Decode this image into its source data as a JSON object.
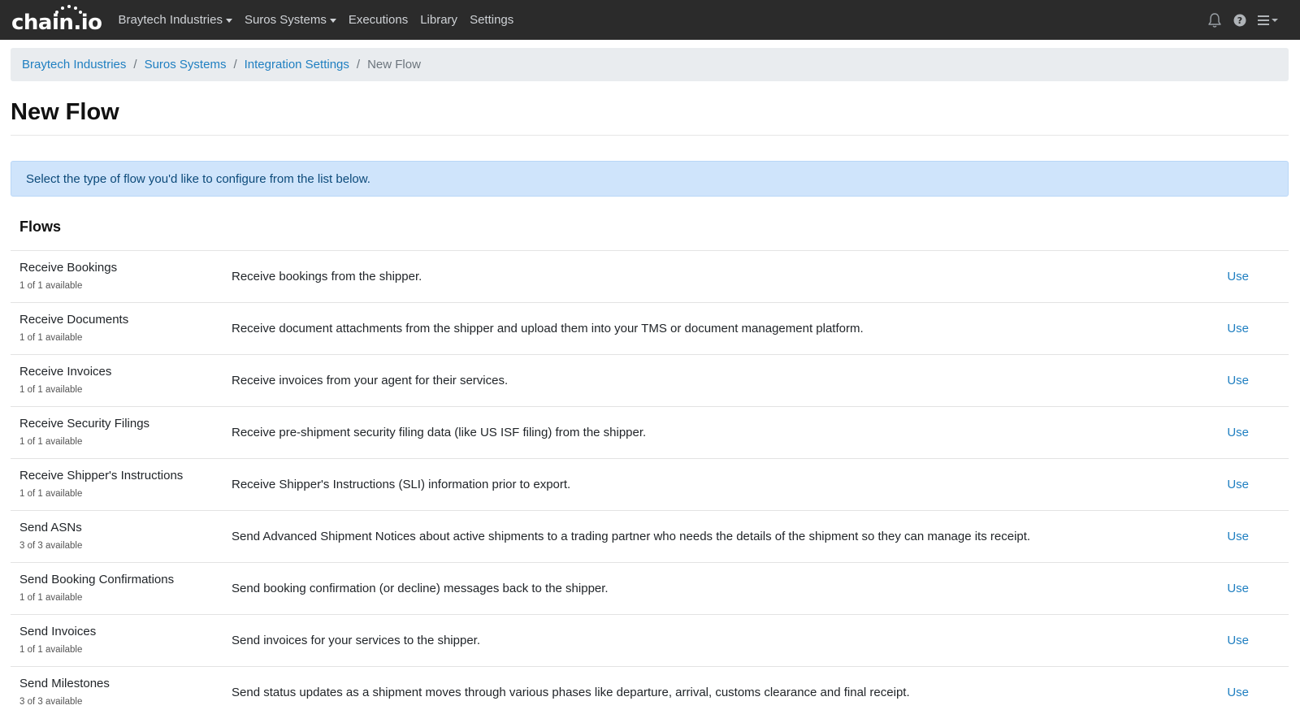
{
  "navbar": {
    "brand": "chain.io",
    "items": [
      {
        "label": "Braytech Industries",
        "dropdown": true
      },
      {
        "label": "Suros Systems",
        "dropdown": true
      },
      {
        "label": "Executions",
        "dropdown": false
      },
      {
        "label": "Library",
        "dropdown": false
      },
      {
        "label": "Settings",
        "dropdown": false
      }
    ],
    "icons": [
      "bell-icon",
      "help-icon",
      "hamburger-menu-icon"
    ]
  },
  "breadcrumb": {
    "items": [
      "Braytech Industries",
      "Suros Systems",
      "Integration Settings"
    ],
    "current": "New Flow",
    "separator": "/"
  },
  "page": {
    "title": "New Flow",
    "alert": "Select the type of flow you'd like to configure from the list below."
  },
  "flows": {
    "heading": "Flows",
    "action_label": "Use",
    "rows": [
      {
        "name": "Receive Bookings",
        "availability": "1 of 1 available",
        "description": "Receive bookings from the shipper."
      },
      {
        "name": "Receive Documents",
        "availability": "1 of 1 available",
        "description": "Receive document attachments from the shipper and upload them into your TMS or document management platform."
      },
      {
        "name": "Receive Invoices",
        "availability": "1 of 1 available",
        "description": "Receive invoices from your agent for their services."
      },
      {
        "name": "Receive Security Filings",
        "availability": "1 of 1 available",
        "description": "Receive pre-shipment security filing data (like US ISF filing) from the shipper."
      },
      {
        "name": "Receive Shipper's Instructions",
        "availability": "1 of 1 available",
        "description": "Receive Shipper's Instructions (SLI) information prior to export."
      },
      {
        "name": "Send ASNs",
        "availability": "3 of 3 available",
        "description": "Send Advanced Shipment Notices about active shipments to a trading partner who needs the details of the shipment so they can manage its receipt."
      },
      {
        "name": "Send Booking Confirmations",
        "availability": "1 of 1 available",
        "description": "Send booking confirmation (or decline) messages back to the shipper."
      },
      {
        "name": "Send Invoices",
        "availability": "1 of 1 available",
        "description": "Send invoices for your services to the shipper."
      },
      {
        "name": "Send Milestones",
        "availability": "3 of 3 available",
        "description": "Send status updates as a shipment moves through various phases like departure, arrival, customs clearance and final receipt."
      }
    ]
  },
  "colors": {
    "navbar_bg": "#2b2b2b",
    "link": "#1f7fc1",
    "alert_bg": "#cfe4fb",
    "breadcrumb_bg": "#e9ecef"
  }
}
